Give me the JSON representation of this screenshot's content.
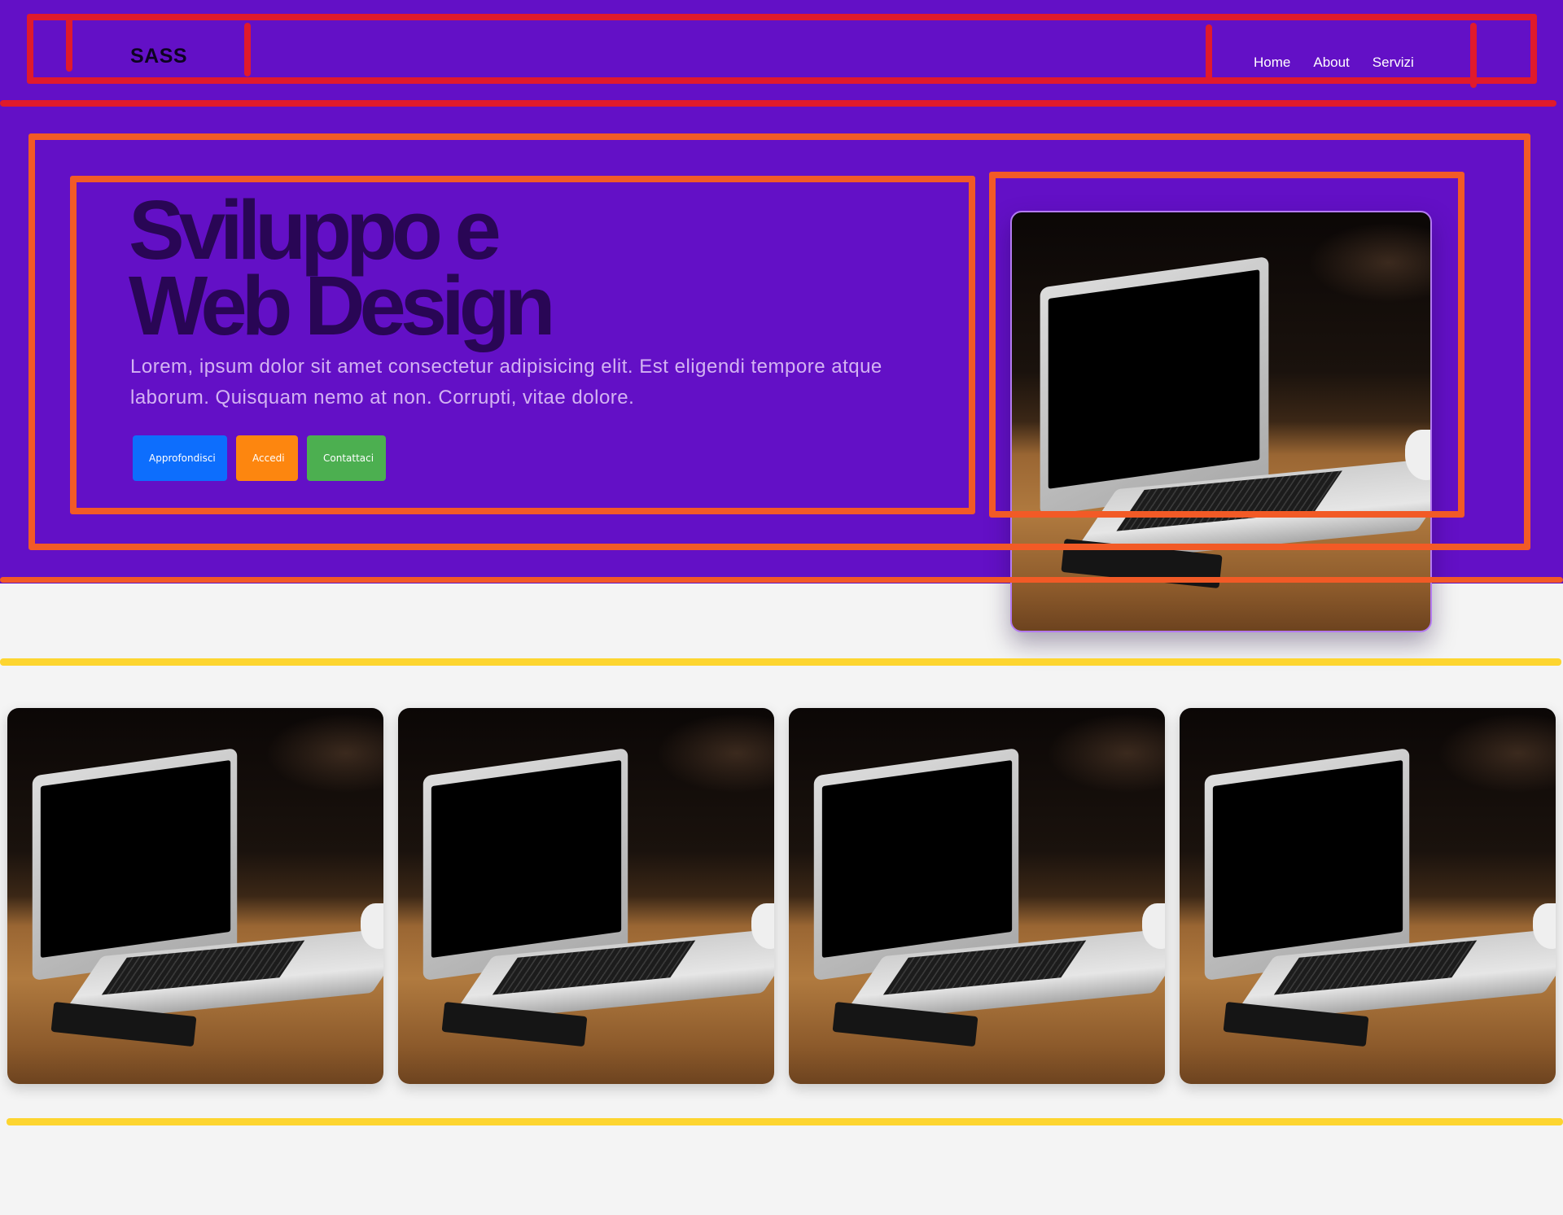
{
  "navbar": {
    "brand": "SASS",
    "links": [
      "Home",
      "About",
      "Servizi"
    ]
  },
  "hero": {
    "title_line1": "Sviluppo e",
    "title_line2": "Web Design",
    "text": "Lorem, ipsum dolor sit amet consectetur adipisicing elit. Est eligendi tempore atque laborum. Quisquam nemo at non. Corrupti, vitae dolore.",
    "buttons": {
      "primary": "Approfondisci",
      "warning": "Accedi",
      "success": "Contattaci"
    }
  },
  "images": {
    "hero": "laptop-on-wooden-table",
    "gallery": [
      "laptop-on-wooden-table",
      "laptop-on-wooden-table",
      "laptop-on-wooden-table",
      "laptop-on-wooden-table"
    ]
  },
  "colors": {
    "band": "#6310c6",
    "title": "#290655",
    "text": "#d3b3f2",
    "primary": "#0d6efd",
    "warning": "#fd860f",
    "success": "#4caf50",
    "annotation_red": "#e01a2c",
    "annotation_orange": "#f25a26",
    "annotation_yellow": "#fdd530"
  }
}
